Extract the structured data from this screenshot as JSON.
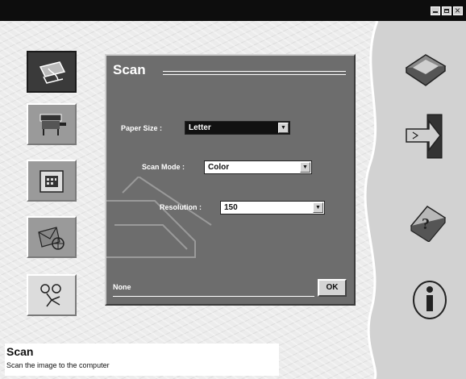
{
  "window": {
    "title": ""
  },
  "panel": {
    "title": "Scan",
    "paper_size": {
      "label": "Paper Size :",
      "value": "Letter"
    },
    "scan_mode": {
      "label": "Scan Mode :",
      "value": "Color"
    },
    "resolution": {
      "label": "Resolution :",
      "value": "150"
    },
    "status": "None",
    "ok_label": "OK"
  },
  "footer": {
    "title": "Scan",
    "description": "Scan the image to the computer"
  },
  "icons": {
    "left": [
      "scanner-icon",
      "copier-icon",
      "fax-icon",
      "email-icon",
      "ocr-icon"
    ],
    "right": [
      "scanner-device-icon",
      "exit-door-icon",
      "help-book-icon",
      "info-icon"
    ]
  }
}
